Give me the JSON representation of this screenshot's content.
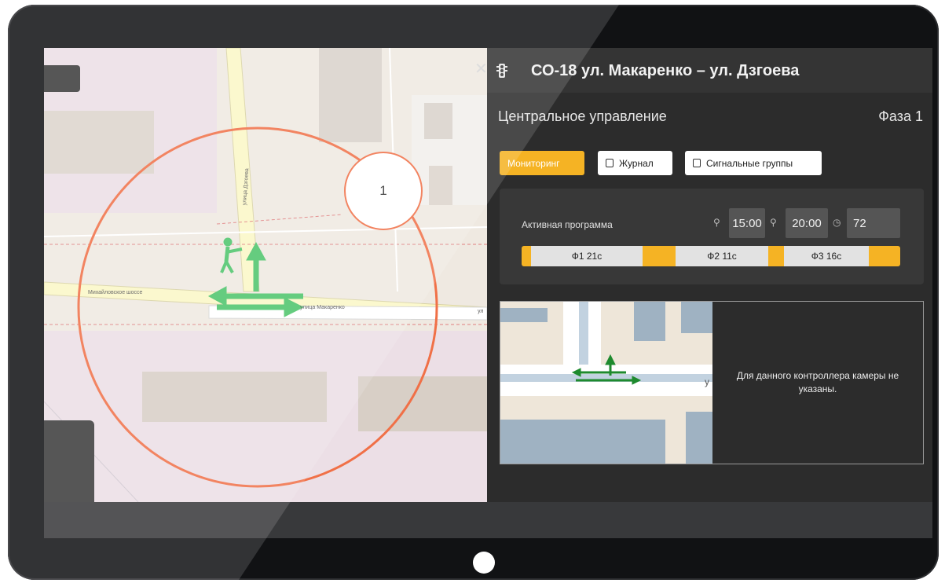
{
  "window": {
    "title": "СО-18 ул. Макаренко – ул. Дзгоева",
    "close_icon": "close-icon",
    "traffic_light_icon": "traffic-light-icon"
  },
  "map": {
    "phase_marker": "1",
    "road_labels": {
      "highway": "Михайловское шоссе",
      "vertical_street": "улица Дзгоева",
      "horizontal_street": "улица Макаренко",
      "edge_fragment": "ул"
    },
    "colors": {
      "radius_circle": "#f07047",
      "movement_arrows": "#4cc46a"
    }
  },
  "panel": {
    "mode": "Центральное управление",
    "phase": "Фаза 1",
    "tabs": [
      {
        "label": "Мониторинг",
        "icon": "",
        "active": true
      },
      {
        "label": "Журнал",
        "icon": "journal-icon",
        "active": false
      },
      {
        "label": "Сигнальные группы",
        "icon": "external-link-icon",
        "active": false
      }
    ],
    "program": {
      "label": "Активная программа",
      "start_time": "15:00",
      "end_time": "20:00",
      "cycle": "72",
      "phases": [
        {
          "label": "Ф1 21с",
          "duration": 21
        },
        {
          "label": "Ф2 11с",
          "duration": 11
        },
        {
          "label": "Ф3 16с",
          "duration": 16
        }
      ]
    },
    "camera": {
      "message": "Для данного контроллера камеры не указаны.",
      "mini_map_fragment": "у"
    }
  },
  "colors": {
    "accent": "#f5b324",
    "panel_bg": "#2c2c2c",
    "arrow_dark": "#1e8a2e"
  }
}
